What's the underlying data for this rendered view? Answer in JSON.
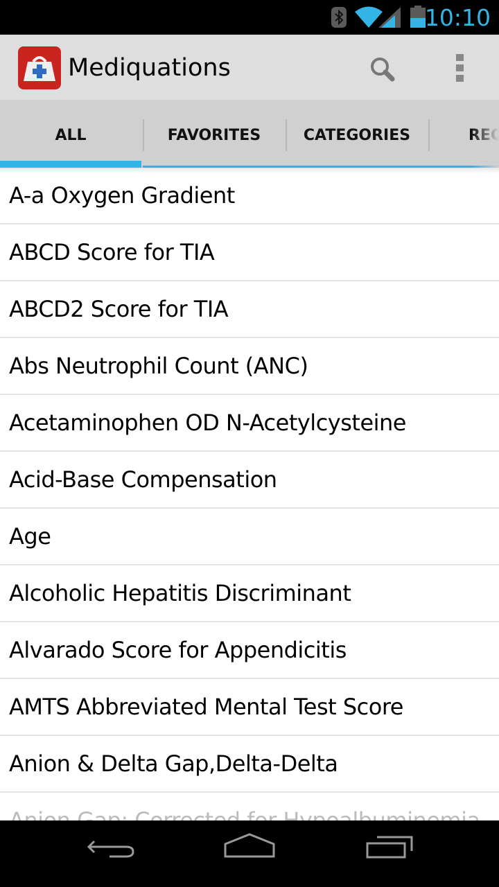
{
  "status_bar": {
    "time": "10:10",
    "icons": [
      "bluetooth-icon",
      "wifi-icon",
      "signal-icon",
      "battery-icon"
    ],
    "battery_level": 0.5,
    "accent_color": "#33b5e5"
  },
  "action_bar": {
    "app_title": "Mediquations",
    "app_icon": "medical-bag-icon",
    "actions": [
      "search-icon",
      "overflow-menu-icon"
    ]
  },
  "tabs": [
    {
      "label": "ALL",
      "active": true
    },
    {
      "label": "FAVORITES",
      "active": false
    },
    {
      "label": "CATEGORIES",
      "active": false
    },
    {
      "label": "REC",
      "active": false
    }
  ],
  "list": {
    "items": [
      "A-a Oxygen Gradient",
      "ABCD Score for TIA",
      "ABCD2 Score for TIA",
      "Abs Neutrophil Count (ANC)",
      "Acetaminophen OD N-Acetylcysteine",
      "Acid-Base Compensation",
      "Age",
      "Alcoholic Hepatitis Discriminant",
      "Alvarado Score for Appendicitis",
      "AMTS Abbreviated Mental Test Score",
      "Anion & Delta Gap,Delta-Delta",
      "Anion Gap: Corrected for Hypoalbuminemia"
    ]
  },
  "nav_bar": {
    "buttons": [
      "back-icon",
      "home-icon",
      "recent-apps-icon"
    ]
  }
}
